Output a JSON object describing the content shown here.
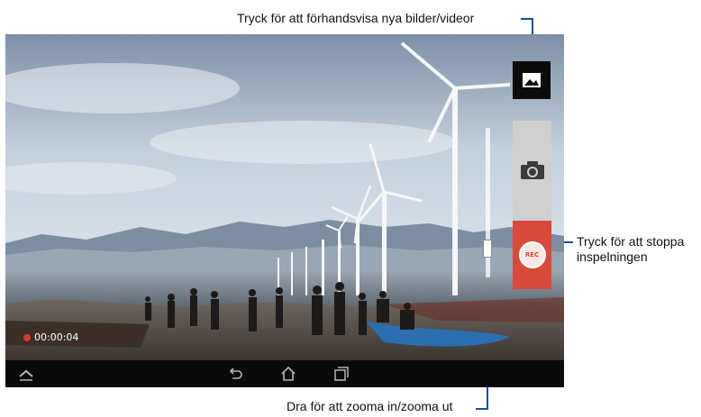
{
  "callouts": {
    "preview": "Tryck för att förhandsvisa nya bilder/videor",
    "stop_line1": "Tryck för att stoppa",
    "stop_line2": "inspelningen",
    "zoom": "Dra för att zooma in/zooma ut"
  },
  "recording": {
    "time": "00:00:04",
    "rec_label": "REC"
  },
  "zoom": {
    "level": 0.15
  },
  "icons": {
    "gallery": "gallery-thumbnail-icon",
    "camera": "camera-icon",
    "record": "record-icon",
    "nav_up": "chevron-up-icon",
    "nav_back": "back-icon",
    "nav_home": "home-icon",
    "nav_recent": "recent-apps-icon"
  },
  "colors": {
    "callout_line": "#1e4e9a",
    "record_button": "#d7493b",
    "camera_button": "#d0d0d0"
  }
}
